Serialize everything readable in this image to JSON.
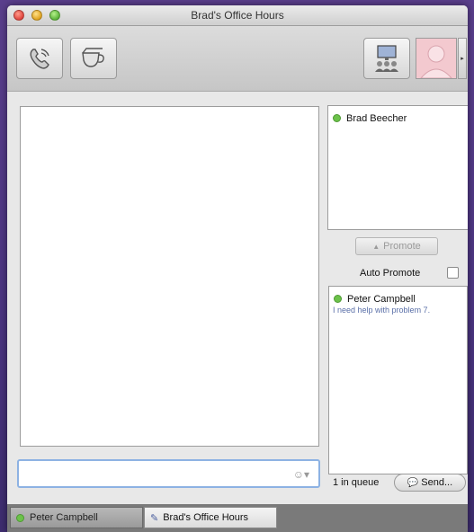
{
  "window": {
    "title": "Brad's Office Hours"
  },
  "toolbar": {
    "phone_icon": "phone-icon",
    "cup_icon": "tea-cup-icon",
    "screen_icon": "video-conference-icon",
    "avatar_icon": "avatar-icon"
  },
  "participants": [
    {
      "name": "Brad Beecher",
      "status": "online",
      "status_color": "#6cc24a"
    }
  ],
  "promote": {
    "label": "Promote"
  },
  "auto_promote": {
    "label": "Auto Promote",
    "checked": false
  },
  "queue": {
    "items": [
      {
        "name": "Peter Campbell",
        "message": "I need help with problem 7.",
        "status_color": "#6cc24a"
      }
    ],
    "count_label": "1 in queue"
  },
  "send": {
    "label": "Send..."
  },
  "tabs": [
    {
      "label": "Peter Campbell",
      "active": false
    },
    {
      "label": "Brad's Office Hours",
      "active": true
    }
  ]
}
